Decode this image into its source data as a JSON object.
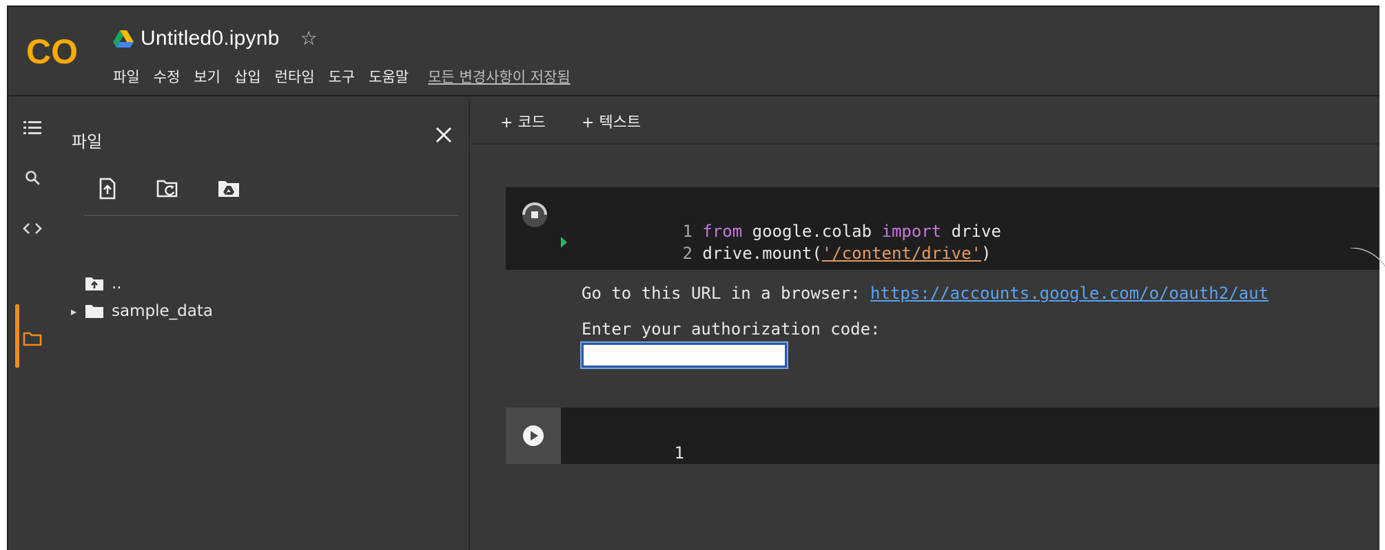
{
  "app": {
    "notebook_title": "Untitled0.ipynb",
    "star": "☆",
    "logo_text": "CO"
  },
  "menu": {
    "items": [
      "파일",
      "수정",
      "보기",
      "삽입",
      "런타임",
      "도구",
      "도움말"
    ],
    "save_status": "모든 변경사항이 저장됨"
  },
  "sidebar": {
    "panel_title": "파일",
    "close": "✕",
    "tree": [
      {
        "label": "..",
        "icon": "folder-up-icon"
      },
      {
        "label": "sample_data",
        "icon": "folder-icon",
        "expand": "▸"
      }
    ],
    "icons": [
      "menu-icon",
      "search-icon",
      "code-icon",
      "folder-icon"
    ],
    "tool_icons": [
      "upload-file-icon",
      "refresh-folder-icon",
      "mount-drive-icon"
    ]
  },
  "toolbar": {
    "add_code": "+ 코드",
    "add_text": "+ 텍스트"
  },
  "cells": {
    "cell1": {
      "lines": [
        {
          "num": "1",
          "tokens": [
            [
              "kw",
              "from"
            ],
            [
              "plain",
              " google.colab "
            ],
            [
              "kw",
              "import"
            ],
            [
              "plain",
              " drive"
            ]
          ]
        },
        {
          "num": "2",
          "tokens": [
            [
              "plain",
              "drive.mount("
            ],
            [
              "str",
              "'/content/drive'"
            ],
            [
              "plain",
              ")"
            ]
          ]
        }
      ],
      "output": {
        "prompt": "Go to this URL in a browser: ",
        "url": "https://accounts.google.com/o/oauth2/aut",
        "auth_label": "Enter your authorization code:",
        "auth_value": ""
      }
    },
    "cell2": {
      "line_num": "1"
    }
  },
  "colors": {
    "accent": "#f28b1c",
    "background": "#383838",
    "cell_bg": "#1e1e1e",
    "keyword": "#c678dd",
    "string": "#e69a60",
    "link": "#5aa4f2"
  }
}
